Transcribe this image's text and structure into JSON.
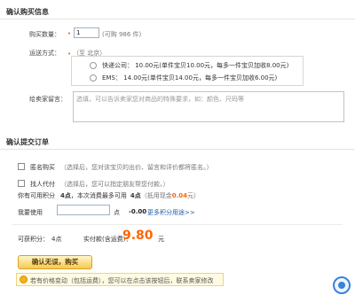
{
  "confirm_purchase": {
    "title": "确认购买信息",
    "quantity_label": "购买数量：",
    "quantity_value": "1",
    "quantity_available": "(可购  986 件)",
    "shipping_label": "运送方式：",
    "shipping_from": "（至  北京）",
    "shipping_options": [
      {
        "label": "快递公司：  10.00元(单件宝贝10.00元，每多一件宝贝加收8.00元)",
        "selected": false
      },
      {
        "label": "EMS：  14.00元(单件宝贝14.00元，每多一件宝贝加收6.00元)",
        "selected": false
      }
    ],
    "message_label": "给卖家留言：",
    "message_placeholder": "选填，可以告诉卖家您对商品的特殊要求，如：颜色、尺码等"
  },
  "confirm_order": {
    "title": "确认提交订单",
    "anonymous_label": "匿名购买",
    "anonymous_hint": "（选择后，您对该宝贝的出价、留言和评价都将匿名。）",
    "proxy_label": "找人代付",
    "proxy_hint": "（选择后，您可以指定朋友帮您付款。）",
    "points_prefix": "你有可用积分",
    "points_value": "4点",
    "points_mid": "，本次消费最多可用",
    "points_usable": "4点",
    "points_cash_prefix": "（抵用现金",
    "points_cash": "0.04",
    "points_cash_suffix": "元）",
    "use_label": "我要使用",
    "use_unit": "点",
    "use_deduct": "-0.00",
    "more_points_link": "更多积分用途>>",
    "earn_label": "可获积分：",
    "earn_value": "4点",
    "payment_label": "实付款(含运费)：",
    "payment_value": "9.80",
    "payment_unit": "元",
    "confirm_button": "确认无误，购买",
    "notice_text": "若有价格变动（包括运费），您可以在点击该按钮后，联系卖家修改"
  },
  "colors": {
    "accent": "#ff6600",
    "link": "#1e5fa8",
    "button_top": "#fff6cc",
    "button_bottom": "#f6c851"
  }
}
